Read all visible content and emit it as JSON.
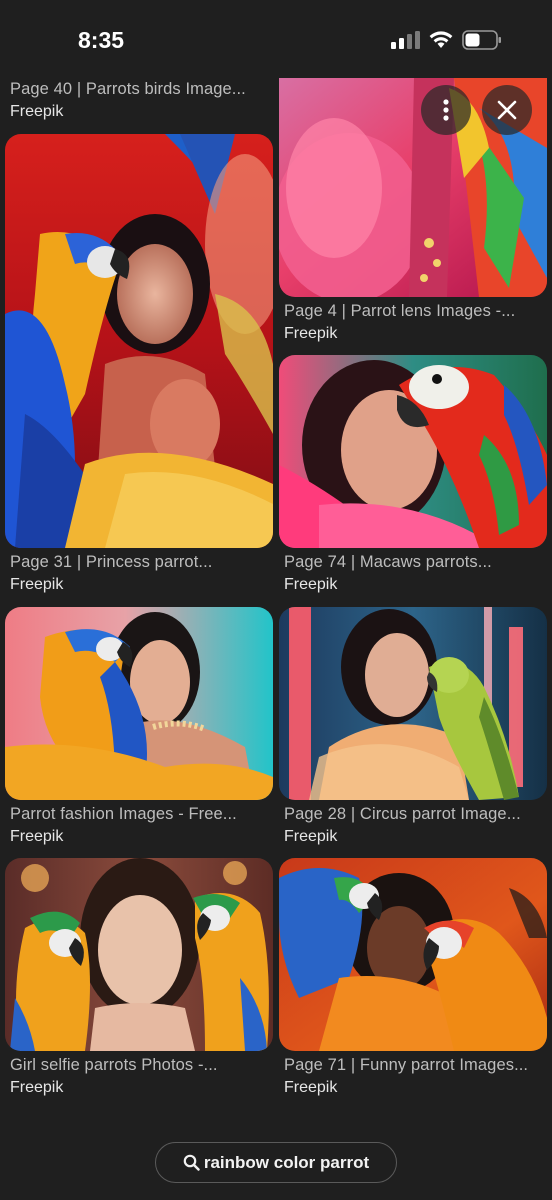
{
  "status_bar": {
    "time": "8:35"
  },
  "results": [
    {
      "caption": "Page 40 | Parrots birds Image...",
      "source": "Freepik"
    },
    {
      "caption": "Page 4 | Parrot lens Images -...",
      "source": "Freepik"
    },
    {
      "caption": "Page 31 | Princess parrot...",
      "source": "Freepik"
    },
    {
      "caption": "Page 74 | Macaws parrots...",
      "source": "Freepik"
    },
    {
      "caption": "Parrot fashion Images - Free...",
      "source": "Freepik"
    },
    {
      "caption": "Page 28 | Circus parrot Image...",
      "source": "Freepik"
    },
    {
      "caption": "Girl selfie parrots Photos -...",
      "source": "Freepik"
    },
    {
      "caption": "Page 71 | Funny parrot Images...",
      "source": "Freepik"
    }
  ],
  "related_search": {
    "label": "rainbow color parrot",
    "icon": "search-icon"
  }
}
